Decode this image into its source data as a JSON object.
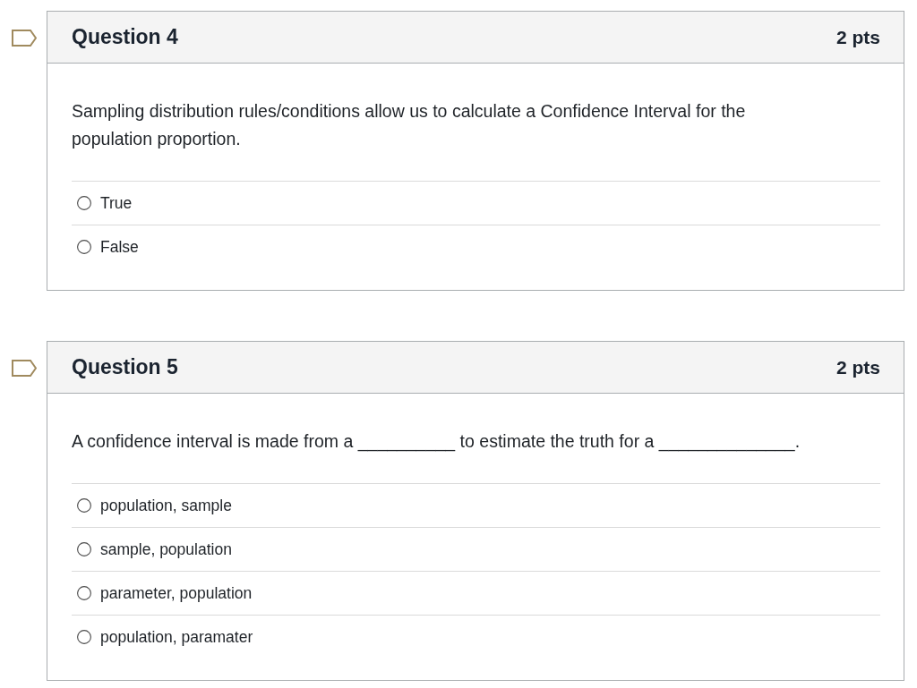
{
  "questions": [
    {
      "flagged": false,
      "title": "Question 4",
      "points": "2 pts",
      "text": "Sampling distribution rules/conditions allow us to calculate a Confidence Interval for the population proportion.",
      "answers": [
        {
          "label": "True",
          "selected": false
        },
        {
          "label": "False",
          "selected": false
        }
      ]
    },
    {
      "flagged": false,
      "title": "Question 5",
      "points": "2 pts",
      "text": "A confidence interval is made from a __________ to estimate the truth for a ______________.",
      "answers": [
        {
          "label": "population, sample",
          "selected": false
        },
        {
          "label": "sample, population",
          "selected": false
        },
        {
          "label": "parameter, population",
          "selected": false
        },
        {
          "label": "population, paramater",
          "selected": false
        }
      ]
    }
  ]
}
